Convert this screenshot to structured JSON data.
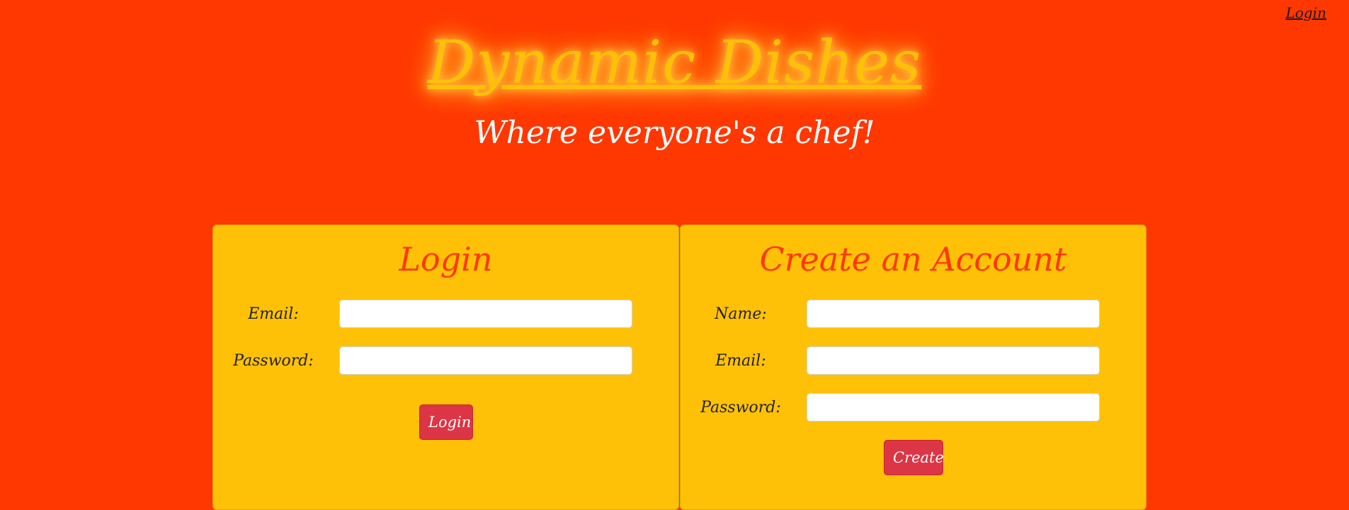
{
  "nav": {
    "login_link": "Login"
  },
  "brand": {
    "title": "Dynamic Dishes",
    "tagline": "Where everyone's a chef!"
  },
  "login_form": {
    "heading": "Login",
    "email_label": "Email:",
    "email_value": "",
    "password_label": "Password:",
    "password_value": "",
    "submit_label": "Login"
  },
  "create_form": {
    "heading": "Create an Account",
    "name_label": "Name:",
    "name_value": "",
    "email_label": "Email:",
    "email_value": "",
    "password_label": "Password:",
    "password_value": "",
    "submit_label": "Create"
  },
  "colors": {
    "background": "#FF3700",
    "panel": "#FFC107",
    "heading": "#FF3700",
    "button": "#DC3545",
    "title_glow": "#FFC107"
  }
}
